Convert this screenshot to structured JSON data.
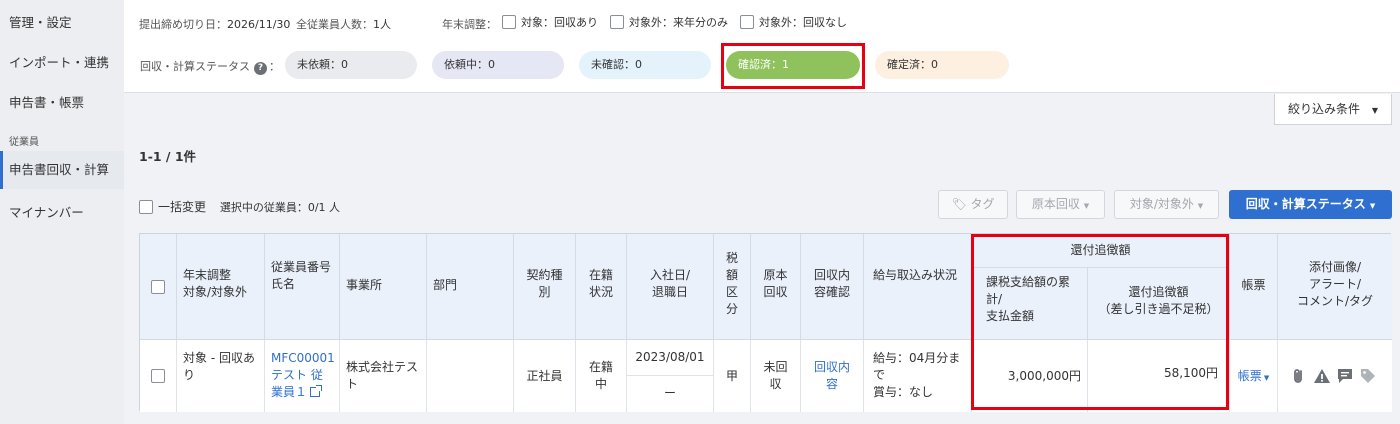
{
  "sidebar": {
    "items": [
      {
        "label": "管理・設定"
      },
      {
        "label": "インポート・連携"
      },
      {
        "label": "申告書・帳票"
      },
      {
        "label": "申告書回収・計算"
      },
      {
        "label": "マイナンバー"
      }
    ],
    "section": "従業員"
  },
  "header": {
    "deadline_label": "提出締め切り日：",
    "deadline": "2026/11/30",
    "employees_label": "全従業員人数：",
    "employees": "1人",
    "adjust_label": "年末調整：",
    "options": [
      "対象：回収あり",
      "対象外：来年分のみ",
      "対象外：回収なし"
    ],
    "status_label": "回収・計算ステータス",
    "status_colon": "：",
    "help": "?",
    "statuses": [
      {
        "label": "未依頼：0",
        "color": "#e9ebee"
      },
      {
        "label": "依頼中：0",
        "color": "#e6e7f5"
      },
      {
        "label": "未確認：0",
        "color": "#e3f2fb"
      },
      {
        "label": "確認済：1",
        "color": "#8fc25c"
      },
      {
        "label": "確定済：0",
        "color": "#fdf0e0"
      }
    ]
  },
  "toolbar": {
    "filter_label": "絞り込み条件",
    "count": "1-1 / 1件",
    "bulk_label": "一括変更",
    "selected": "選択中の従業員：0/1 人",
    "tag_label": "タグ",
    "original_label": "原本回収",
    "target_label": "対象/対象外",
    "status_button": "回収・計算ステータス"
  },
  "table": {
    "headers": {
      "adjust": "年末調整\n対象/対象外",
      "employee": "従業員番号\n氏名",
      "office": "事業所",
      "dept": "部門",
      "contract": "契約種別",
      "enrollment": "在籍状況",
      "dates": "入社日/\n退職日",
      "tax": "税額区分",
      "original": "原本回収",
      "content": "回収内容確認",
      "salary": "給与取込み状況",
      "refund_group": "還付追徴額",
      "cumulative": "課税支給額の累計/\n支払金額",
      "refund": "還付追徴額\n（差し引き過不足税）",
      "forms": "帳票",
      "attachments": "添付画像/\nアラート/\nコメント/タグ"
    },
    "row": {
      "adjust": "対象 - 回収あり",
      "employee_id": "MFC00001",
      "employee_name": "テスト 従業員１",
      "office": "株式会社テスト",
      "dept": "",
      "contract": "正社員",
      "enrollment": "在籍中",
      "join_date": "2023/08/01",
      "leave_date": "ー",
      "tax": "甲",
      "original": "未回収",
      "content": "回収内容",
      "salary": "給与：04月分まで\n賞与：なし",
      "cumulative": "3,000,000円",
      "refund": "58,100円",
      "forms": "帳票"
    }
  },
  "colors": {
    "accent": "#2f6fd0",
    "highlight": "#e60012"
  }
}
